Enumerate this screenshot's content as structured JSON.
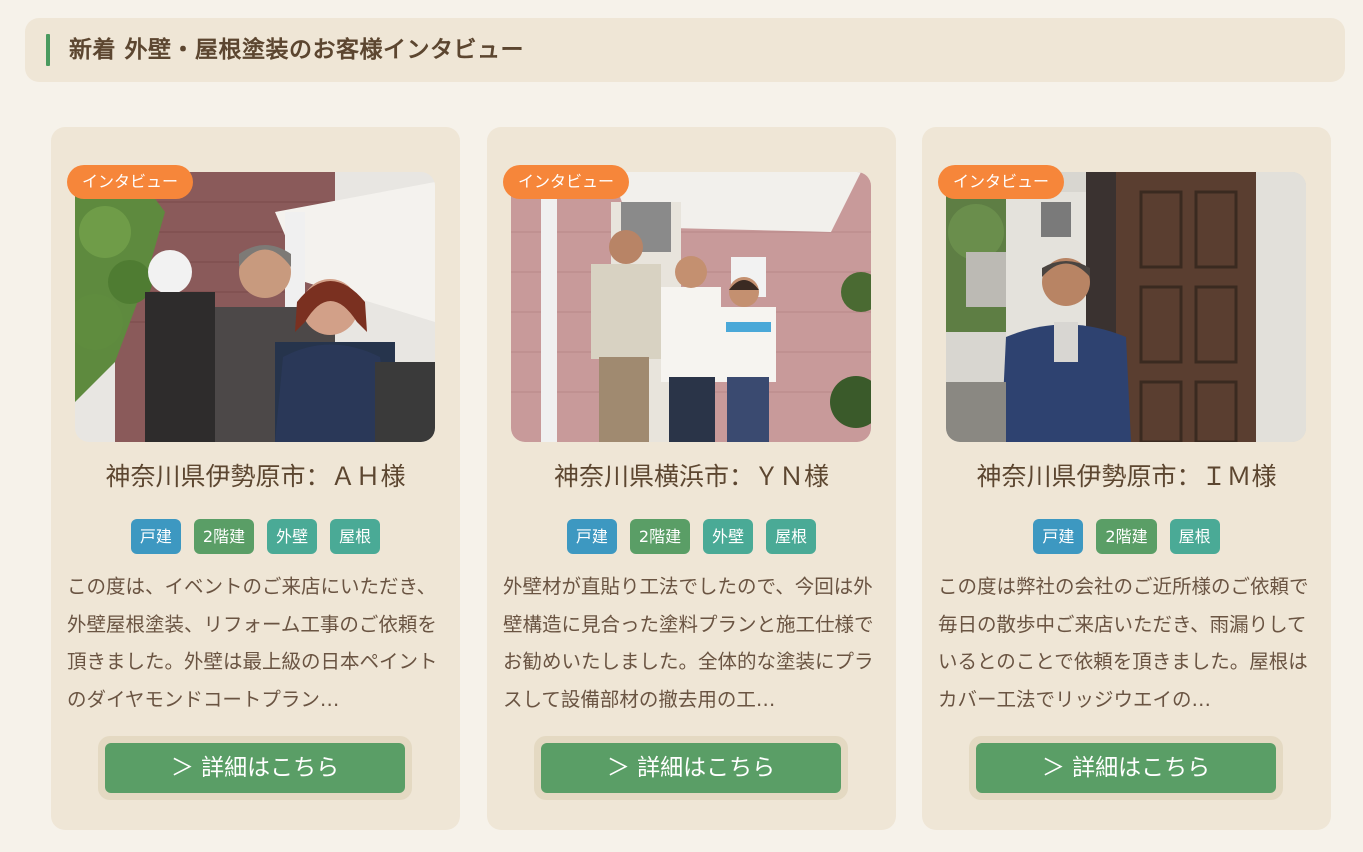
{
  "header": {
    "title": "新着 外壁・屋根塗装のお客様インタビュー"
  },
  "cards": [
    {
      "badge": "インタビュー",
      "name": "神奈川県伊勢原市：ＡＨ様",
      "tags": [
        "戸建",
        "2階建",
        "外壁",
        "屋根"
      ],
      "description": "この度は、イベントのご来店にいただき、外壁屋根塗装、リフォーム工事のご依頼を頂きました。外壁は最上級の日本ペイントのダイヤモンドコートプラン…",
      "button_label": "＞ 詳細はこちら"
    },
    {
      "badge": "インタビュー",
      "name": "神奈川県横浜市：ＹＮ様",
      "tags": [
        "戸建",
        "2階建",
        "外壁",
        "屋根"
      ],
      "description": "外壁材が直貼り工法でしたので、今回は外壁構造に見合った塗料プランと施工仕様でお勧めいたしました。全体的な塗装にプラスして設備部材の撤去用の工…",
      "button_label": "＞ 詳細はこちら"
    },
    {
      "badge": "インタビュー",
      "name": "神奈川県伊勢原市：ＩＭ様",
      "tags": [
        "戸建",
        "2階建",
        "屋根"
      ],
      "description": "この度は弊社の会社のご近所様のご依頼で毎日の散歩中ご来店いただき、雨漏りしているとのことで依頼を頂きました。屋根はカバー工法でリッジウエイの…",
      "button_label": "＞ 詳細はこちら"
    }
  ],
  "colors": {
    "accent_green": "#5a9e66",
    "badge_orange": "#f6863a",
    "tag_blue": "#3d98c1",
    "tag_teal": "#4aaa96",
    "card_bg": "#efe6d6",
    "text_brown": "#5c4630"
  }
}
